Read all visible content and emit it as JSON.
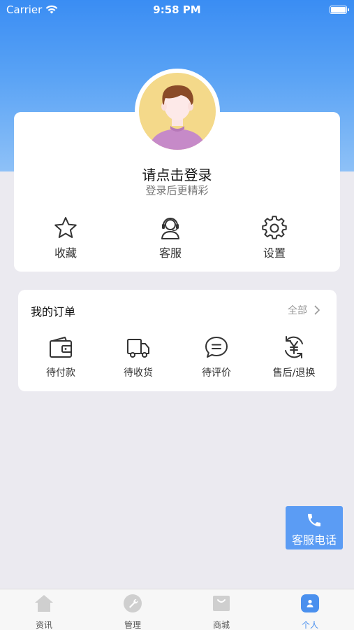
{
  "status_bar": {
    "carrier": "Carrier",
    "time": "9:58 PM"
  },
  "profile": {
    "title": "请点击登录",
    "subtitle": "登录后更精彩"
  },
  "quick_actions": [
    {
      "label": "收藏",
      "icon": "star-icon"
    },
    {
      "label": "客服",
      "icon": "headset-icon"
    },
    {
      "label": "设置",
      "icon": "gear-icon"
    }
  ],
  "orders": {
    "title": "我的订单",
    "all_label": "全部",
    "items": [
      {
        "label": "待付款",
        "icon": "wallet-icon"
      },
      {
        "label": "待收货",
        "icon": "truck-icon"
      },
      {
        "label": "待评价",
        "icon": "comment-icon"
      },
      {
        "label": "售后/退换",
        "icon": "yen-refresh-icon"
      }
    ]
  },
  "service_button": {
    "label": "客服电话",
    "icon": "phone-icon"
  },
  "tabbar": {
    "tabs": [
      {
        "label": "资讯",
        "icon": "home-icon"
      },
      {
        "label": "管理",
        "icon": "wrench-icon"
      },
      {
        "label": "商城",
        "icon": "shop-icon"
      },
      {
        "label": "个人",
        "icon": "person-icon",
        "active": true
      }
    ]
  },
  "colors": {
    "accent": "#3a8df3",
    "active_tab": "#4a90ee",
    "inactive_tab_icon": "#cfcfcf",
    "avatar_bg": "#f4d98a",
    "shirt": "#c68ac8",
    "hair": "#8a4b28"
  }
}
